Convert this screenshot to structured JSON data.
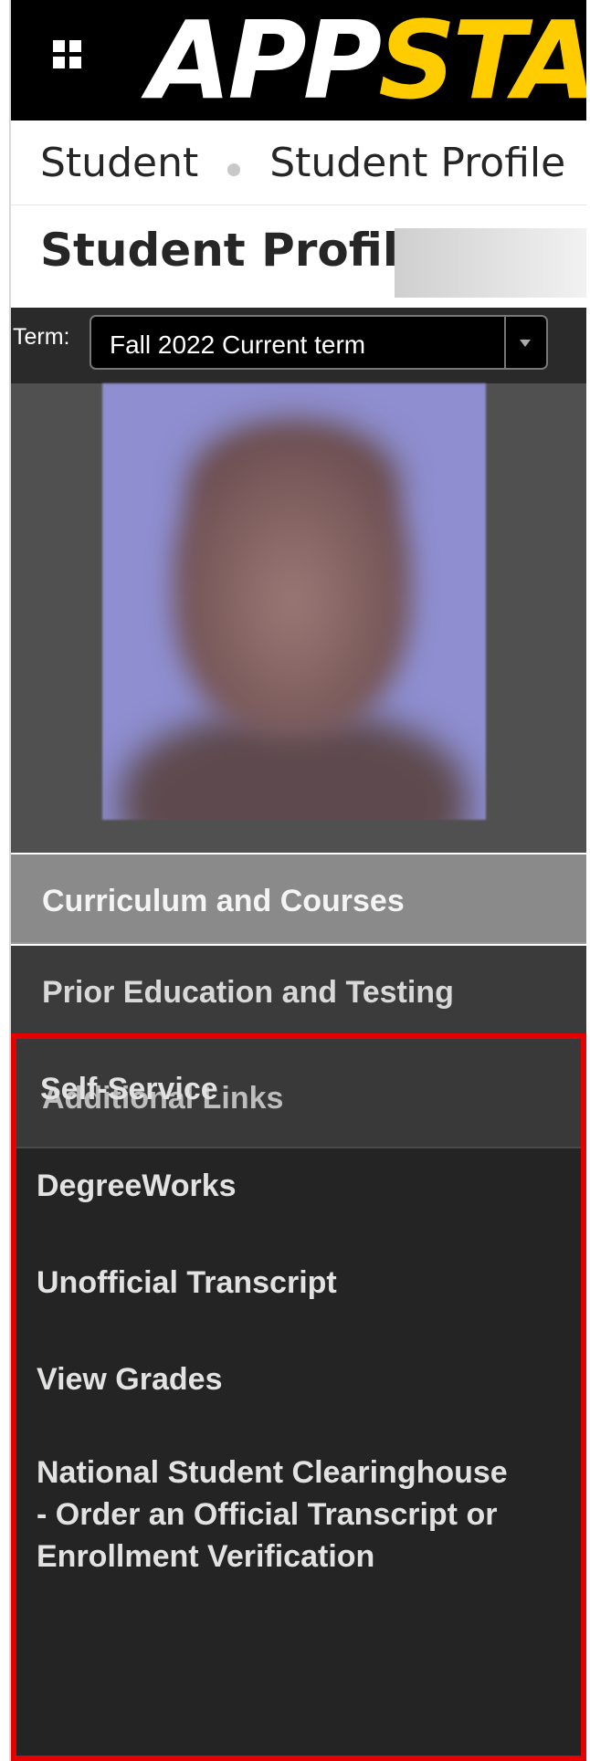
{
  "header": {
    "logo_part1": "APP",
    "logo_part2": "STATE",
    "colors": {
      "background": "#000000",
      "brand_yellow": "#ffcc00"
    },
    "menu_icon": "grid-icon"
  },
  "breadcrumb": {
    "items": [
      "Student",
      "Student Profile"
    ]
  },
  "page": {
    "title": "Student Profile"
  },
  "term": {
    "label": "Term:",
    "selected": "Fall 2022 Current term"
  },
  "nav": {
    "items": [
      {
        "label": "Curriculum and Courses"
      },
      {
        "label": "Prior Education and Testing"
      }
    ]
  },
  "additional_links": {
    "heading": "Additional Links",
    "links": [
      {
        "label": "Self-Service"
      },
      {
        "label": "DegreeWorks"
      },
      {
        "label": "Unofficial Transcript"
      },
      {
        "label": "View Grades"
      },
      {
        "label": "National Student Clearinghouse - Order an Official Transcript or Enrollment Verification"
      }
    ],
    "highlight_color": "#e60000"
  }
}
